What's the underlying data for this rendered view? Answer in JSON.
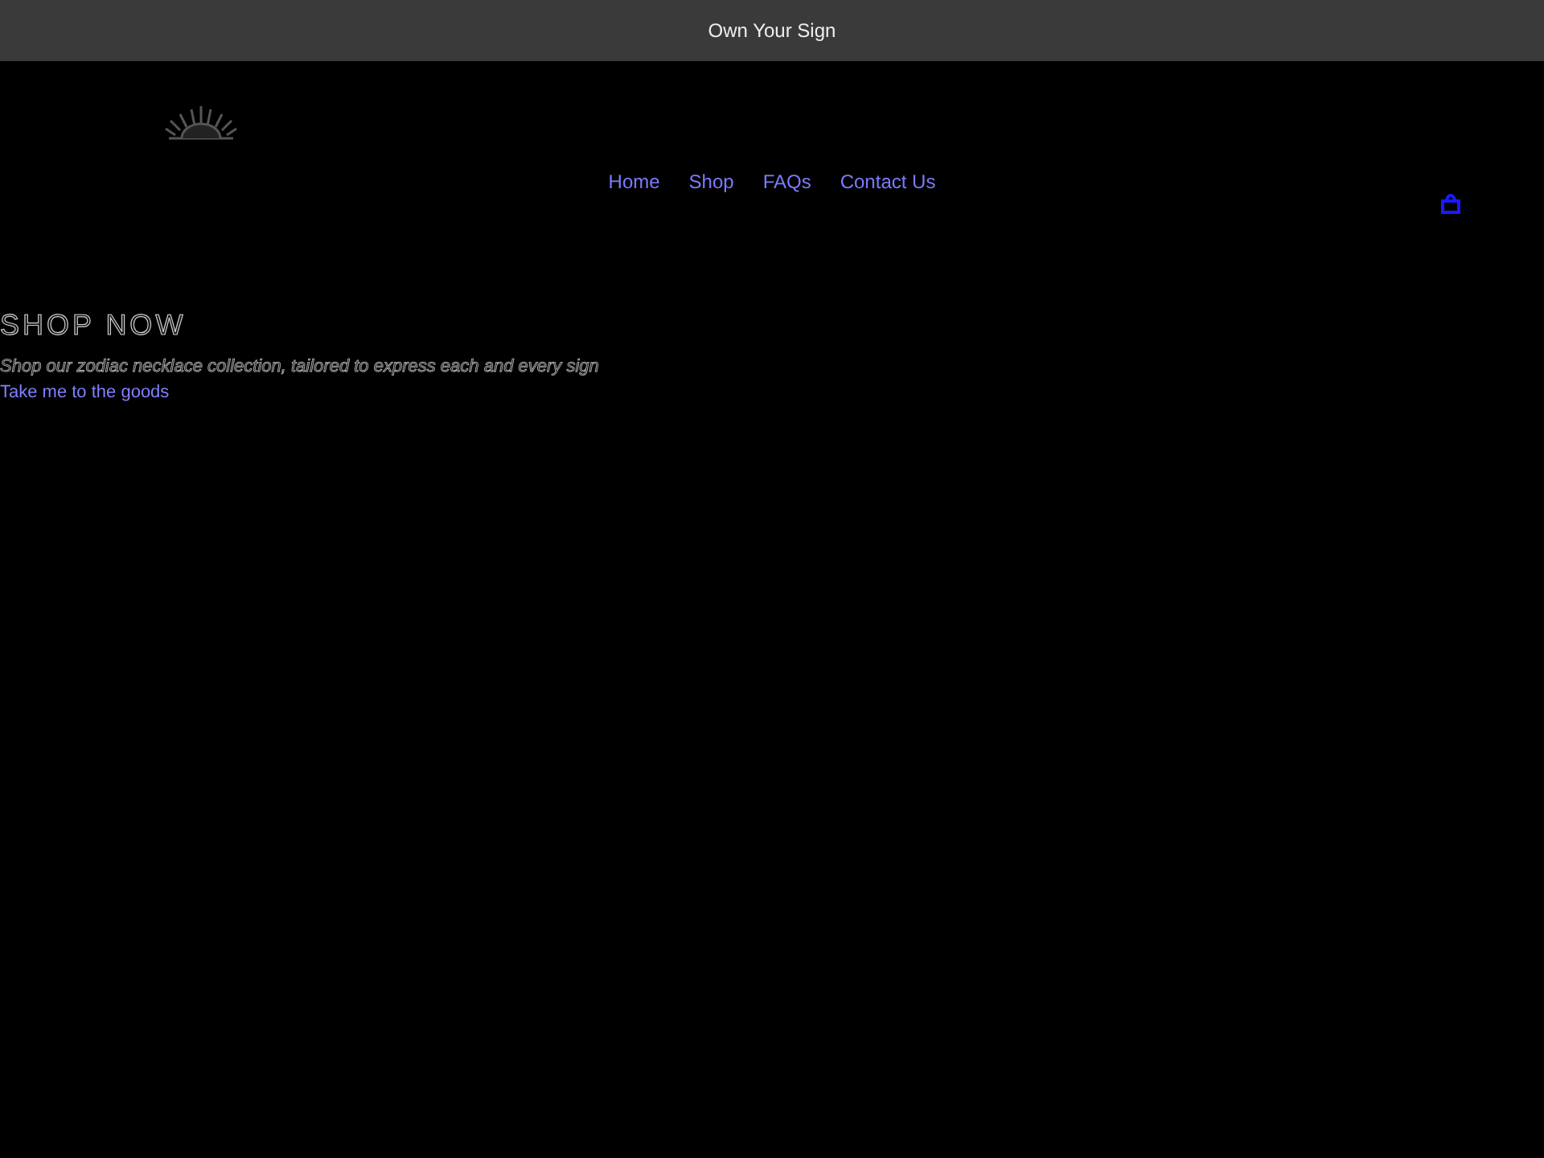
{
  "announcement": "Own Your Sign",
  "nav": [
    {
      "label": "Home"
    },
    {
      "label": "Shop"
    },
    {
      "label": "FAQs"
    },
    {
      "label": "Contact Us"
    }
  ],
  "hero": {
    "heading": "SHOP NOW",
    "text": "Shop our zodiac necklace collection, tailored to express each and every sign",
    "link": "Take me to the goods"
  }
}
